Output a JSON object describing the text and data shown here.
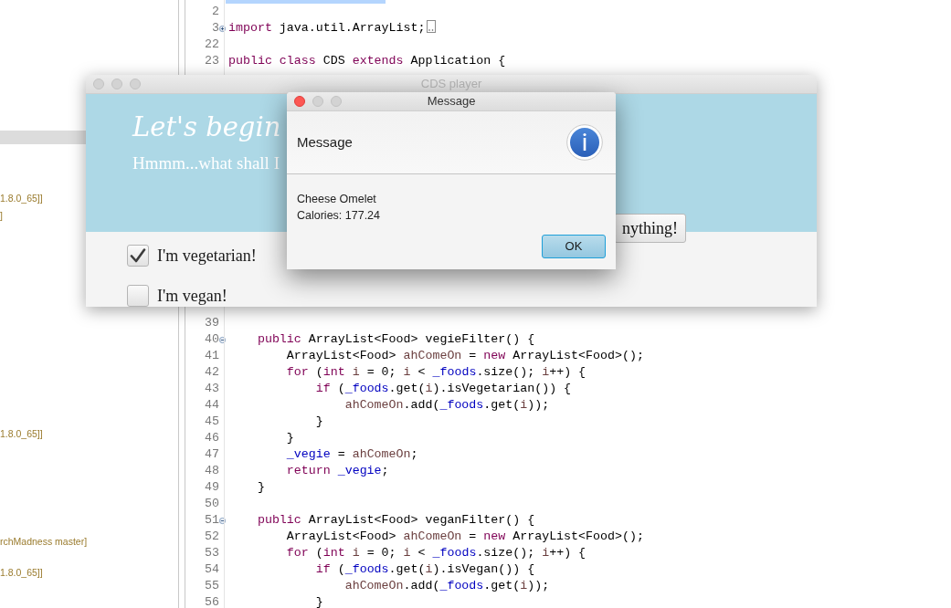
{
  "sidebar": {
    "items": [
      {
        "text": "1.8.0_65]]"
      },
      {
        "text": "]"
      },
      {
        "text": "1.8.0_65]]"
      },
      {
        "text": "rchMadness master]"
      },
      {
        "text": "1.8.0_65]]"
      }
    ]
  },
  "editor": {
    "blocks": [
      {
        "lines": [
          {
            "number": "2"
          },
          {
            "number": "3",
            "folded": true,
            "tokens": [
              {
                "text": "import",
                "kind": "keyword"
              },
              {
                "text": " java.util.ArrayList;",
                "kind": "plain"
              }
            ]
          },
          {
            "number": "22"
          },
          {
            "number": "23",
            "tokens": [
              {
                "text": "public class",
                "kind": "keyword"
              },
              {
                "text": " CDS ",
                "kind": "plain"
              },
              {
                "text": "extends",
                "kind": "keyword"
              },
              {
                "text": " Application {",
                "kind": "plain"
              }
            ]
          }
        ]
      },
      {
        "lines": [
          {
            "number": "39"
          },
          {
            "number": "40",
            "folded": false,
            "tokens": [
              {
                "text": "    public",
                "kind": "keyword"
              },
              {
                "text": " ArrayList<Food> vegieFilter() {",
                "kind": "plain"
              }
            ]
          },
          {
            "number": "41",
            "tokens": [
              {
                "text": "        ArrayList<Food> ",
                "kind": "plain"
              },
              {
                "text": "ahComeOn",
                "kind": "local"
              },
              {
                "text": " = ",
                "kind": "plain"
              },
              {
                "text": "new",
                "kind": "keyword"
              },
              {
                "text": " ArrayList<Food>();",
                "kind": "plain"
              }
            ]
          },
          {
            "number": "42",
            "tokens": [
              {
                "text": "        for",
                "kind": "keyword"
              },
              {
                "text": " (",
                "kind": "plain"
              },
              {
                "text": "int",
                "kind": "keyword"
              },
              {
                "text": " i",
                "kind": "local"
              },
              {
                "text": " = 0; ",
                "kind": "plain"
              },
              {
                "text": "i",
                "kind": "local"
              },
              {
                "text": " < ",
                "kind": "plain"
              },
              {
                "text": "_foods",
                "kind": "field"
              },
              {
                "text": ".size(); ",
                "kind": "plain"
              },
              {
                "text": "i",
                "kind": "local"
              },
              {
                "text": "++) {",
                "kind": "plain"
              }
            ]
          },
          {
            "number": "43",
            "tokens": [
              {
                "text": "            if",
                "kind": "keyword"
              },
              {
                "text": " (",
                "kind": "plain"
              },
              {
                "text": "_foods",
                "kind": "field"
              },
              {
                "text": ".get(",
                "kind": "plain"
              },
              {
                "text": "i",
                "kind": "local"
              },
              {
                "text": ").isVegetarian()) {",
                "kind": "plain"
              }
            ]
          },
          {
            "number": "44",
            "tokens": [
              {
                "text": "                ahComeOn",
                "kind": "local"
              },
              {
                "text": ".add(",
                "kind": "plain"
              },
              {
                "text": "_foods",
                "kind": "field"
              },
              {
                "text": ".get(",
                "kind": "plain"
              },
              {
                "text": "i",
                "kind": "local"
              },
              {
                "text": "));",
                "kind": "plain"
              }
            ]
          },
          {
            "number": "45",
            "tokens": [
              {
                "text": "            }",
                "kind": "plain"
              }
            ]
          },
          {
            "number": "46",
            "tokens": [
              {
                "text": "        }",
                "kind": "plain"
              }
            ]
          },
          {
            "number": "47",
            "tokens": [
              {
                "text": "        _vegie",
                "kind": "field"
              },
              {
                "text": " = ",
                "kind": "plain"
              },
              {
                "text": "ahComeOn",
                "kind": "local"
              },
              {
                "text": ";",
                "kind": "plain"
              }
            ]
          },
          {
            "number": "48",
            "tokens": [
              {
                "text": "        return",
                "kind": "keyword"
              },
              {
                "text": " _vegie",
                "kind": "field"
              },
              {
                "text": ";",
                "kind": "plain"
              }
            ]
          },
          {
            "number": "49",
            "tokens": [
              {
                "text": "    }",
                "kind": "plain"
              }
            ]
          },
          {
            "number": "50"
          },
          {
            "number": "51",
            "folded": false,
            "tokens": [
              {
                "text": "    public",
                "kind": "keyword"
              },
              {
                "text": " ArrayList<Food> veganFilter() {",
                "kind": "plain"
              }
            ]
          },
          {
            "number": "52",
            "tokens": [
              {
                "text": "        ArrayList<Food> ",
                "kind": "plain"
              },
              {
                "text": "ahComeOn",
                "kind": "local"
              },
              {
                "text": " = ",
                "kind": "plain"
              },
              {
                "text": "new",
                "kind": "keyword"
              },
              {
                "text": " ArrayList<Food>();",
                "kind": "plain"
              }
            ]
          },
          {
            "number": "53",
            "tokens": [
              {
                "text": "        for",
                "kind": "keyword"
              },
              {
                "text": " (",
                "kind": "plain"
              },
              {
                "text": "int",
                "kind": "keyword"
              },
              {
                "text": " i",
                "kind": "local"
              },
              {
                "text": " = 0; ",
                "kind": "plain"
              },
              {
                "text": "i",
                "kind": "local"
              },
              {
                "text": " < ",
                "kind": "plain"
              },
              {
                "text": "_foods",
                "kind": "field"
              },
              {
                "text": ".size(); ",
                "kind": "plain"
              },
              {
                "text": "i",
                "kind": "local"
              },
              {
                "text": "++) {",
                "kind": "plain"
              }
            ]
          },
          {
            "number": "54",
            "tokens": [
              {
                "text": "            if",
                "kind": "keyword"
              },
              {
                "text": " (",
                "kind": "plain"
              },
              {
                "text": "_foods",
                "kind": "field"
              },
              {
                "text": ".get(",
                "kind": "plain"
              },
              {
                "text": "i",
                "kind": "local"
              },
              {
                "text": ").isVegan()) {",
                "kind": "plain"
              }
            ]
          },
          {
            "number": "55",
            "tokens": [
              {
                "text": "                ahComeOn",
                "kind": "local"
              },
              {
                "text": ".add(",
                "kind": "plain"
              },
              {
                "text": "_foods",
                "kind": "field"
              },
              {
                "text": ".get(",
                "kind": "plain"
              },
              {
                "text": "i",
                "kind": "local"
              },
              {
                "text": "));",
                "kind": "plain"
              }
            ]
          },
          {
            "number": "56",
            "tokens": [
              {
                "text": "            }",
                "kind": "plain"
              }
            ]
          }
        ]
      }
    ]
  },
  "app_window": {
    "title": "CDS player",
    "heading": "Let's begin",
    "subtitle": "Hmmm...what shall I",
    "button": "nything!",
    "checkboxes": [
      {
        "label": "I'm vegetarian!",
        "checked": true
      },
      {
        "label": "I'm vegan!",
        "checked": false
      }
    ]
  },
  "dialog": {
    "title": "Message",
    "header": "Message",
    "lines": [
      "Cheese Omelet",
      "Calories: 177.24"
    ],
    "button": "OK"
  }
}
